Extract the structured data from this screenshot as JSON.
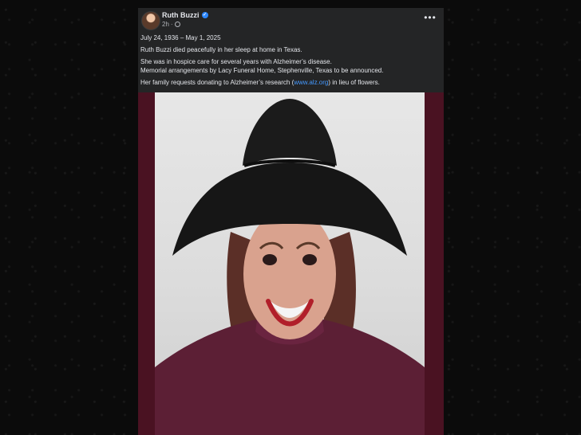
{
  "post": {
    "author": "Ruth Buzzi",
    "time": "2h",
    "icons": {
      "more": "more-icon",
      "verified": "verified-icon",
      "privacy": "globe-icon"
    },
    "dates": "July 24, 1936 – May 1, 2025",
    "line1": "Ruth Buzzi died peacefully in her sleep at home in Texas.",
    "line2": "She was in hospice care for several years with Alzheimer’s disease.",
    "line3": "Memorial arrangements by Lacy Funeral Home, Stephenville, Texas to be announced.",
    "line4_prefix": "Her family requests donating to Alzheimer’s research (",
    "link": "www.alz.org",
    "line4_suffix": ") in lieu of flowers."
  },
  "colors": {
    "background": "#0b0b0b",
    "card": "#242526",
    "text": "#e4e6eb",
    "muted": "#b0b3b8",
    "link": "#4599ff",
    "photo_frame": "#4a1222"
  }
}
